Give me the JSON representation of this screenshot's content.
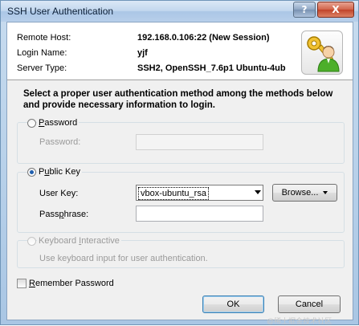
{
  "window": {
    "title": "SSH User Authentication",
    "help_glyph": "?",
    "close_glyph": "X"
  },
  "header": {
    "remote_host_label": "Remote Host:",
    "remote_host_value": "192.168.0.106:22 (New Session)",
    "login_name_label": "Login Name:",
    "login_name_value": "yjf",
    "server_type_label": "Server Type:",
    "server_type_value": "SSH2, OpenSSH_7.6p1 Ubuntu-4ub",
    "icon": "keys-user-icon"
  },
  "description": "Select a proper user authentication method among the methods below and provide necessary information to login.",
  "methods": {
    "password": {
      "label_prefix": "",
      "label_accel": "P",
      "label_rest": "assword",
      "selected": false,
      "field_label": "Password:",
      "field_value": ""
    },
    "public_key": {
      "label_prefix": "P",
      "label_accel": "u",
      "label_rest": "blic Key",
      "selected": true,
      "user_key_label": "User Key:",
      "user_key_value": "vbox-ubuntu_rsa",
      "browse_label": "Browse...",
      "passphrase_label_prefix": "Pass",
      "passphrase_label_accel": "p",
      "passphrase_label_rest": "hrase:",
      "passphrase_value": ""
    },
    "keyboard_interactive": {
      "label_prefix": "Keyboard ",
      "label_accel": "I",
      "label_rest": "nteractive",
      "selected": false,
      "enabled": false,
      "help_text": "Use keyboard input for user authentication."
    }
  },
  "remember_password": {
    "label_prefix": "",
    "label_accel": "R",
    "label_rest": "emember Password",
    "checked": false
  },
  "buttons": {
    "ok": "OK",
    "cancel": "Cancel"
  },
  "watermark": "@稀土掘金技术社区",
  "colors": {
    "title_bar": "#c2d7ee",
    "close_button": "#c0432a",
    "radio_selected": "#1f5fae",
    "default_button_border": "#3c7fb1"
  }
}
